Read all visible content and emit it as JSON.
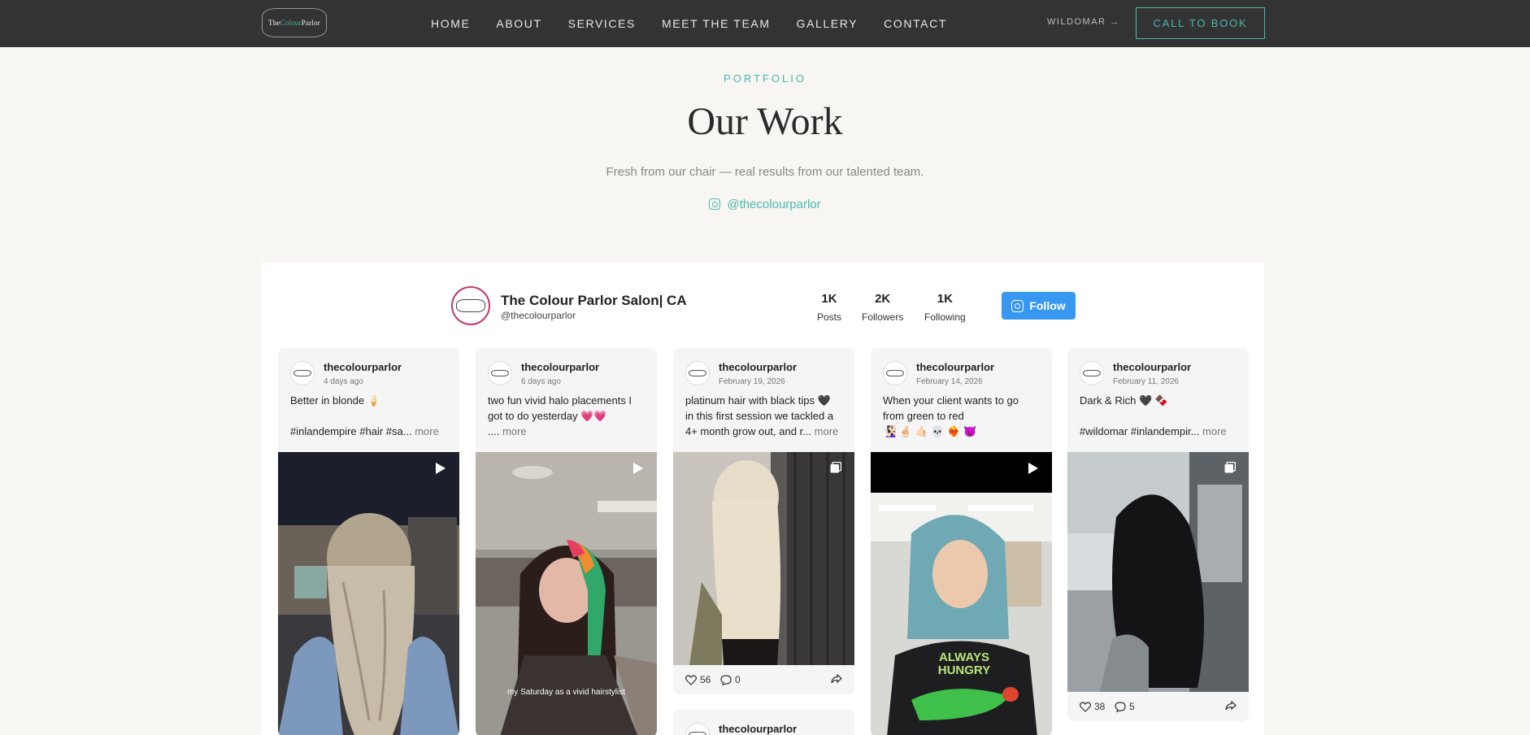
{
  "nav": {
    "logo_prefix": "The",
    "logo_accent": "Colour",
    "logo_suffix": "Parlor",
    "links": [
      "HOME",
      "ABOUT",
      "SERVICES",
      "MEET THE TEAM",
      "GALLERY",
      "CONTACT"
    ],
    "location": "WILDOMAR",
    "location_arrow": "→",
    "cta": "CALL TO BOOK"
  },
  "hero": {
    "eyebrow": "PORTFOLIO",
    "title": "Our Work",
    "subtitle": "Fresh from our chair — real results from our talented team.",
    "handle": "@thecolourparlor"
  },
  "profile": {
    "name": "The Colour Parlor Salon| CA",
    "handle": "@thecolourparlor",
    "stats": [
      {
        "value": "1K",
        "label": "Posts"
      },
      {
        "value": "2K",
        "label": "Followers"
      },
      {
        "value": "1K",
        "label": "Following"
      }
    ],
    "follow_label": "Follow"
  },
  "posts": [
    {
      "user": "thecolourparlor",
      "date": "4 days ago",
      "lines": [
        "Better in blonde 🍦",
        "",
        "#inlandempire #hair #sa..."
      ],
      "more": "more",
      "media": "video",
      "likes": "",
      "comments": ""
    },
    {
      "user": "thecolourparlor",
      "date": "6 days ago",
      "lines": [
        "two fun vivid halo placements I",
        "got to do yesterday 💗💗",
        "...."
      ],
      "more": "more",
      "media": "video",
      "overlay_text": "my Saturday as a vivid hairstylist",
      "likes": "",
      "comments": ""
    },
    {
      "user": "thecolourparlor",
      "date": "February 19, 2026",
      "lines": [
        "platinum hair with black tips 🖤",
        "in this first session we tackled a",
        "4+ month grow out, and r..."
      ],
      "more": "more",
      "media": "carousel",
      "likes": "56",
      "comments": "0"
    },
    {
      "user": "thecolourparlor",
      "date": "February 14, 2026",
      "lines": [
        "When your client wants to go",
        "from green to red",
        "🧏🏻‍♀️ 🤞🏻 🤙🏻 💀 ❤️‍🔥 👿"
      ],
      "more": "",
      "media": "video",
      "shirt_text": "ALWAYS HUNGRY",
      "likes": "",
      "comments": ""
    },
    {
      "user": "thecolourparlor",
      "date": "February 11, 2026",
      "lines": [
        "Dark & Rich 🖤 🍫",
        "",
        "#wildomar #inlandempir..."
      ],
      "more": "more",
      "media": "carousel",
      "likes": "38",
      "comments": "5"
    }
  ],
  "extra_post_user": "thecolourparlor",
  "colors": {
    "accent": "#4bb7ad",
    "nav_bg": "#333333",
    "follow_blue": "#3897f0"
  }
}
